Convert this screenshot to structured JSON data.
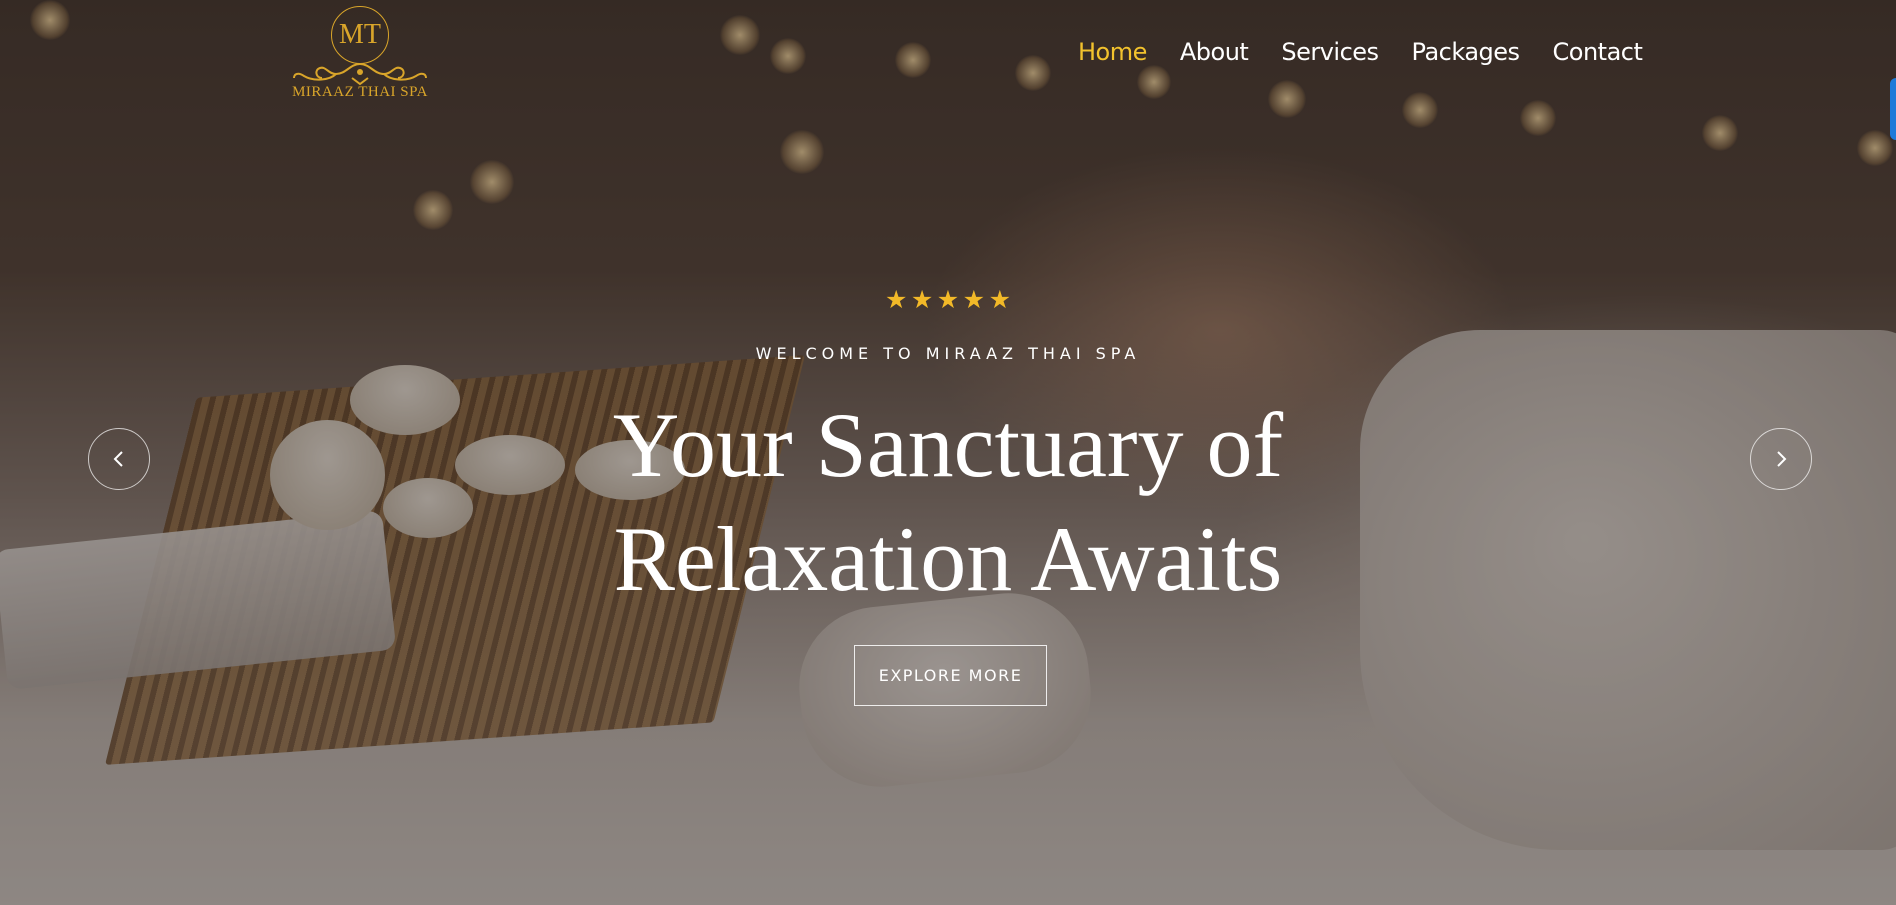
{
  "brand": {
    "monogram": "MT",
    "name": "MIRAAZ THAI SPA",
    "gold": "#d9a52a"
  },
  "nav": {
    "items": [
      {
        "label": "Home",
        "active": true
      },
      {
        "label": "About",
        "active": false
      },
      {
        "label": "Services",
        "active": false
      },
      {
        "label": "Packages",
        "active": false
      },
      {
        "label": "Contact",
        "active": false
      }
    ],
    "active_color": "#f2c22d"
  },
  "hero": {
    "rating": {
      "stars": 5,
      "icon": "star-icon"
    },
    "eyebrow": "WELCOME TO MIRAAZ THAI SPA",
    "headline_line1": "Your Sanctuary of",
    "headline_line2": "Relaxation Awaits",
    "cta_label": "EXPLORE MORE",
    "prev_icon": "chevron-left-icon",
    "next_icon": "chevron-right-icon"
  }
}
